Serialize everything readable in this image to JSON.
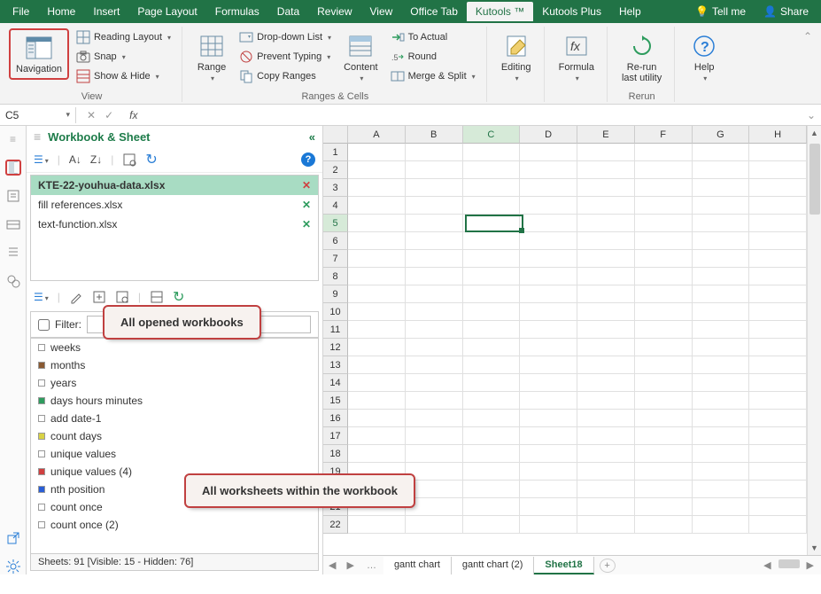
{
  "menubar": {
    "items": [
      "File",
      "Home",
      "Insert",
      "Page Layout",
      "Formulas",
      "Data",
      "Review",
      "View",
      "Office Tab",
      "Kutools ™",
      "Kutools Plus",
      "Help"
    ],
    "active_index": 9,
    "tell_me": "Tell me",
    "share": "Share"
  },
  "ribbon": {
    "groups": [
      {
        "label": "View",
        "big": {
          "label": "Navigation",
          "icon": "navigation-icon"
        },
        "small": [
          {
            "label": "Reading Layout",
            "icon": "reading-layout-icon",
            "caret": true
          },
          {
            "label": "Snap",
            "icon": "camera-icon",
            "caret": true
          },
          {
            "label": "Show & Hide",
            "icon": "show-hide-icon",
            "caret": true
          }
        ]
      },
      {
        "label": "Ranges & Cells",
        "big": {
          "label": "Range",
          "icon": "range-icon",
          "caret": true
        },
        "small": [
          {
            "label": "Drop-down List",
            "icon": "dropdown-list-icon",
            "caret": true
          },
          {
            "label": "Prevent Typing",
            "icon": "prevent-typing-icon",
            "caret": true
          },
          {
            "label": "Copy Ranges",
            "icon": "copy-ranges-icon"
          }
        ],
        "big2": {
          "label": "Content",
          "icon": "content-icon",
          "caret": true
        },
        "small2": [
          {
            "label": "To Actual",
            "icon": "to-actual-icon"
          },
          {
            "label": "Round",
            "icon": "round-icon"
          },
          {
            "label": "Merge & Split",
            "icon": "merge-split-icon",
            "caret": true
          }
        ]
      },
      {
        "label": "",
        "big": {
          "label": "Editing",
          "icon": "editing-icon",
          "caret": true
        }
      },
      {
        "label": "",
        "big": {
          "label": "Formula",
          "icon": "formula-icon",
          "caret": true
        }
      },
      {
        "label": "Rerun",
        "big": {
          "label": "Re-run\nlast utility",
          "icon": "rerun-icon"
        }
      },
      {
        "label": "",
        "big": {
          "label": "Help",
          "icon": "help-icon",
          "caret": true
        }
      }
    ]
  },
  "name_box": "C5",
  "nav": {
    "title": "Workbook & Sheet",
    "workbooks": [
      {
        "name": "KTE-22-youhua-data.xlsx",
        "active": true,
        "close_color": "red"
      },
      {
        "name": "fill references.xlsx",
        "active": false,
        "close_color": "green"
      },
      {
        "name": "text-function.xlsx",
        "active": false,
        "close_color": "green"
      }
    ],
    "filter_label": "Filter:",
    "filter_value": "",
    "sheets": [
      {
        "name": "weeks",
        "color": "transparent"
      },
      {
        "name": "months",
        "color": "#8a5a33"
      },
      {
        "name": "years",
        "color": "transparent"
      },
      {
        "name": "days hours minutes",
        "color": "#2e9c5e"
      },
      {
        "name": "add date-1",
        "color": "transparent"
      },
      {
        "name": "count days",
        "color": "#d8d244"
      },
      {
        "name": "unique values",
        "color": "transparent"
      },
      {
        "name": "unique values (4)",
        "color": "#d04040"
      },
      {
        "name": "nth position",
        "color": "#2a5ed6"
      },
      {
        "name": "count once",
        "color": "transparent"
      },
      {
        "name": "count once (2)",
        "color": "transparent"
      }
    ],
    "status": "Sheets: 91  [Visible: 15 - Hidden: 76]"
  },
  "callouts": {
    "workbooks": "All opened workbooks",
    "worksheets": "All worksheets within the workbook"
  },
  "grid": {
    "cols": [
      "A",
      "B",
      "C",
      "D",
      "E",
      "F",
      "G",
      "H"
    ],
    "row_count": 22,
    "selected_col": 2,
    "selected_row": 4
  },
  "tabs": {
    "items": [
      "gantt chart",
      "gantt chart (2)",
      "Sheet18"
    ],
    "active_index": 2
  }
}
